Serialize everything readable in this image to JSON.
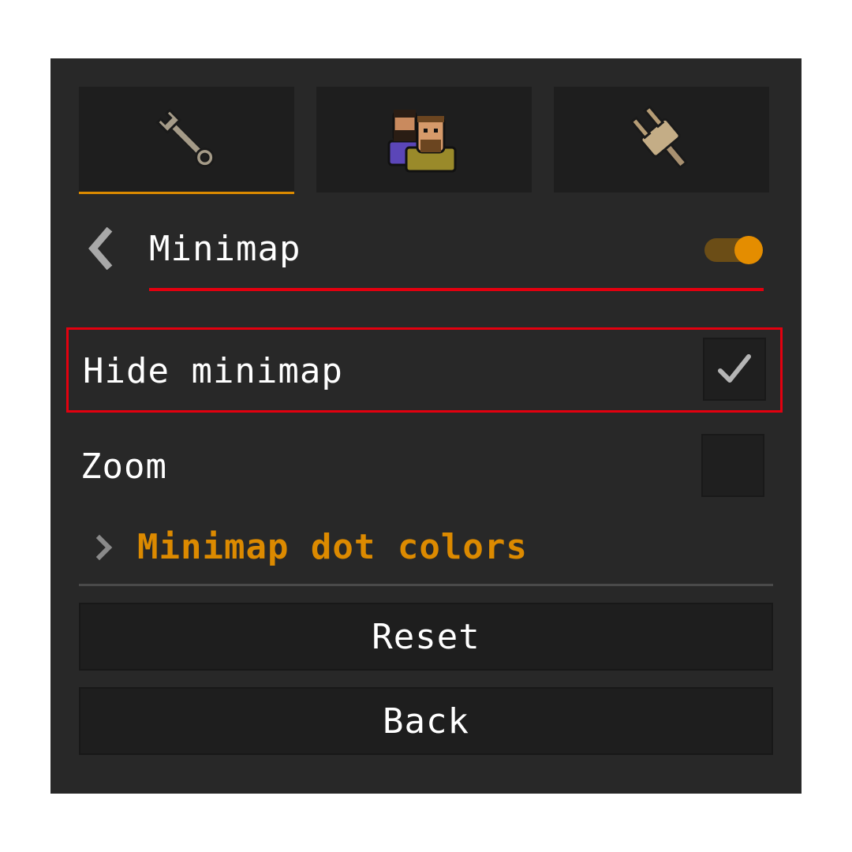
{
  "tabs": [
    {
      "icon": "wrench-icon",
      "selected": true
    },
    {
      "icon": "friends-icon",
      "selected": false
    },
    {
      "icon": "plugin-icon",
      "selected": false
    }
  ],
  "header": {
    "title": "Minimap",
    "toggle_on": true
  },
  "options": [
    {
      "label": "Hide minimap",
      "checked": true,
      "highlighted": true
    },
    {
      "label": "Zoom",
      "checked": false,
      "highlighted": false
    }
  ],
  "sub_section": {
    "label": "Minimap dot colors"
  },
  "buttons": {
    "reset_label": "Reset",
    "back_label": "Back"
  },
  "colors": {
    "accent": "#dc8a00",
    "highlight": "#e3000f",
    "panel_background": "#282828"
  }
}
